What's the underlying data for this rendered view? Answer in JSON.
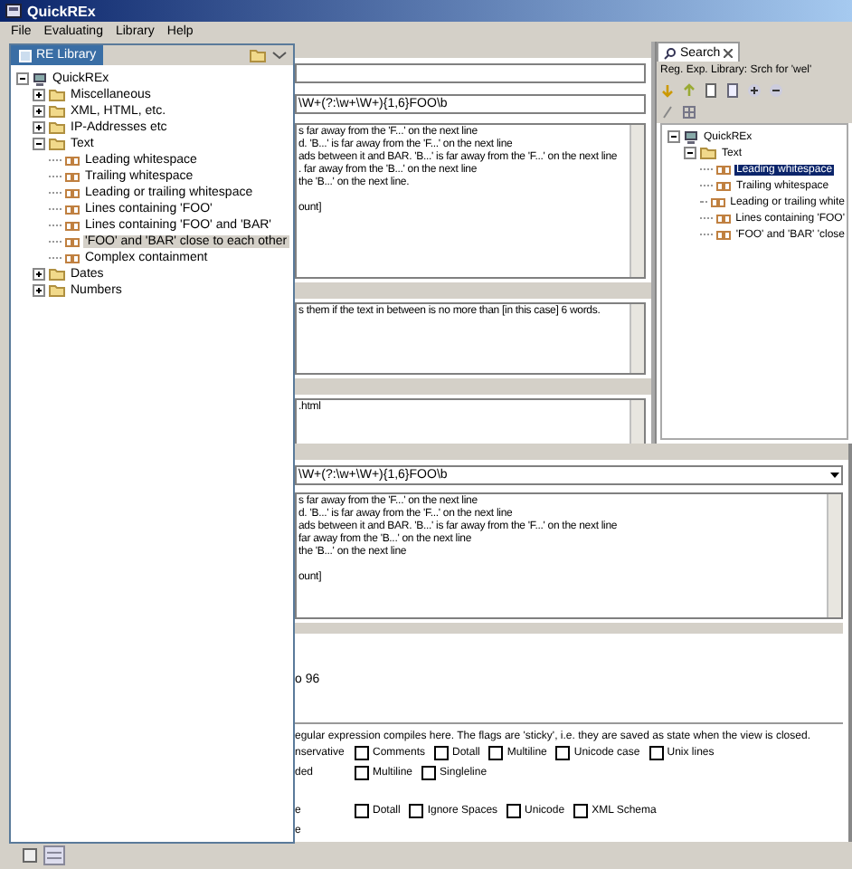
{
  "window": {
    "title": "QuickREx"
  },
  "menu": [
    "File",
    "Evaluating",
    "Library",
    "Help"
  ],
  "library_view": {
    "tab": "RE Library",
    "tree": [
      {
        "label": "QuickREx",
        "kind": "root",
        "expanded": true,
        "selected": false,
        "children": [
          {
            "label": "Miscellaneous",
            "kind": "folder",
            "expanded": false,
            "selected": false
          },
          {
            "label": "XML, HTML, etc.",
            "kind": "folder",
            "expanded": false,
            "selected": false
          },
          {
            "label": "IP-Addresses etc",
            "kind": "folder",
            "expanded": false,
            "selected": false
          },
          {
            "label": "Text",
            "kind": "folder",
            "expanded": true,
            "selected": false,
            "children": [
              {
                "label": "Leading whitespace",
                "kind": "regex",
                "selected": false
              },
              {
                "label": "Trailing whitespace",
                "kind": "regex",
                "selected": false
              },
              {
                "label": "Leading or trailing whitespace",
                "kind": "regex",
                "selected": false
              },
              {
                "label": "Lines containing 'FOO'",
                "kind": "regex",
                "selected": false
              },
              {
                "label": "Lines containing 'FOO' and 'BAR'",
                "kind": "regex",
                "selected": false
              },
              {
                "label": "'FOO' and 'BAR' close to each other",
                "kind": "regex",
                "selected": true
              },
              {
                "label": "Complex containment",
                "kind": "regex",
                "selected": false
              }
            ]
          },
          {
            "label": "Dates",
            "kind": "folder",
            "expanded": false,
            "selected": false
          },
          {
            "label": "Numbers",
            "kind": "folder",
            "expanded": false,
            "selected": false
          }
        ]
      }
    ]
  },
  "search_view": {
    "tab": "Search",
    "filter": "Reg. Exp. Library: Srch for 'wel'",
    "tree": [
      {
        "label": "QuickREx",
        "kind": "root",
        "expanded": true,
        "selected": false,
        "children": [
          {
            "label": "Text",
            "kind": "folder",
            "expanded": true,
            "selected": false,
            "children": [
              {
                "label": "Leading whitespace",
                "kind": "regex",
                "selected": true
              },
              {
                "label": "Trailing whitespace",
                "kind": "regex",
                "selected": false
              },
              {
                "label": "Leading or trailing white",
                "kind": "regex",
                "selected": false
              },
              {
                "label": "Lines containing 'FOO'",
                "kind": "regex",
                "selected": false
              },
              {
                "label": "'FOO' and 'BAR' 'close",
                "kind": "regex",
                "selected": false
              }
            ]
          }
        ]
      }
    ]
  },
  "editor_top": {
    "regex": "\\W+(?:\\w+\\W+){1,6}FOO\\b",
    "test_lines": [
      "s far away from the 'F...' on the next line",
      "d. 'B...' is far away from the 'F...' on the next line",
      "ads between it and BAR. 'B...' is far away from the 'F...' on the next line",
      ". far away from the 'B...' on the next line",
      "the 'B...' on the next line."
    ],
    "summary": "ount]",
    "description": "s them if the text in between is no more than [in this case] 6 words.",
    "file": ".html"
  },
  "editor_bottom": {
    "regex": "\\W+(?:\\w+\\W+){1,6}FOO\\b",
    "test_lines": [
      "s far away from the 'F...' on the next line",
      "d. 'B...' is far away from the 'F...' on the next line",
      "ads between it and BAR. 'B...' is far away from the 'F...' on the next line",
      " far away from the 'B...' on the next line",
      "the 'B...' on the next line"
    ],
    "summary": "ount]",
    "match_info": "o 96",
    "flags_note": "egular expression compiles here. The flags are 'sticky', i.e. they are saved as state when the view is closed.",
    "flag_rows": [
      {
        "lead": "nservative",
        "flags": [
          {
            "label": "Comments",
            "checked": false
          },
          {
            "label": "Dotall",
            "checked": false
          },
          {
            "label": "Multiline",
            "checked": false
          },
          {
            "label": "Unicode case",
            "checked": false
          },
          {
            "label": "Unix lines",
            "checked": false
          }
        ]
      },
      {
        "lead": "ded",
        "flags": [
          {
            "label": "Multiline",
            "checked": false
          },
          {
            "label": "Singleline",
            "checked": false
          }
        ]
      },
      {
        "lead": "e",
        "flags": [
          {
            "label": "Dotall",
            "checked": false
          },
          {
            "label": "Ignore Spaces",
            "checked": false
          },
          {
            "label": "Unicode",
            "checked": false
          },
          {
            "label": "XML Schema",
            "checked": false
          }
        ]
      },
      {
        "lead": "e",
        "flags": []
      }
    ]
  }
}
